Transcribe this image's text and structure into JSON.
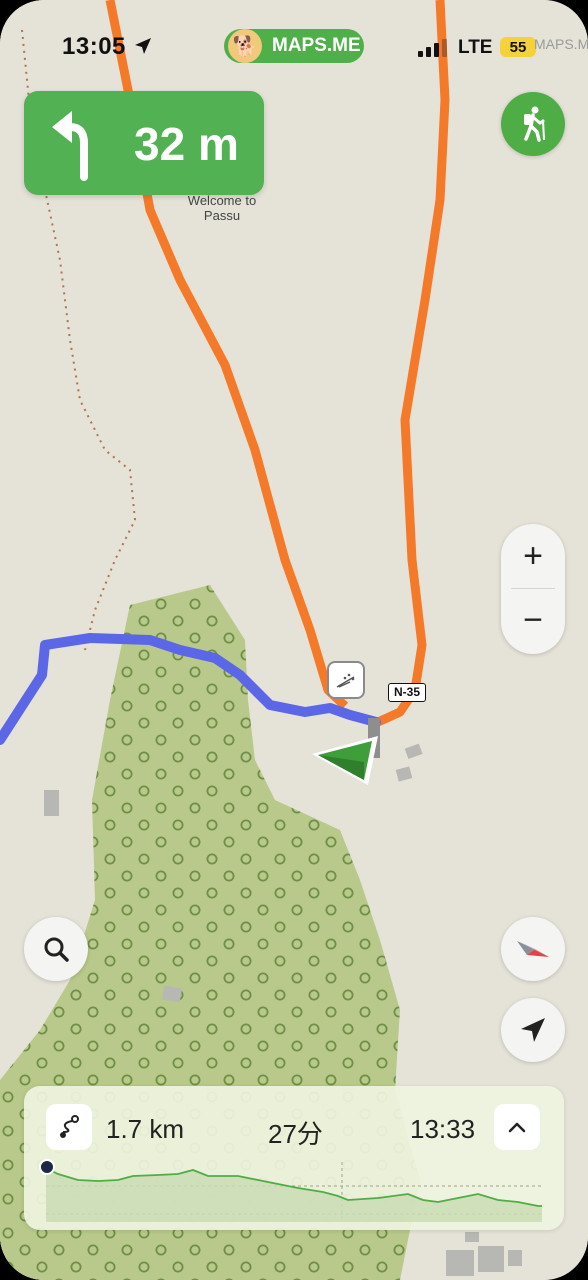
{
  "status_bar": {
    "time": "13:05",
    "app_name": "MAPS.ME",
    "network": "LTE",
    "battery": "55",
    "ghost_label": "MAPS.ME"
  },
  "navigation": {
    "turn_direction": "turn-left",
    "distance_to_turn": "32 m"
  },
  "map": {
    "place_label": "Welcome to Passu",
    "road_badge": "N-35",
    "poi_icon": "viewpoint-icon",
    "colors": {
      "background": "#e5e3d8",
      "forest": "#b9c98b",
      "road": "#f47a2a",
      "route": "#5b67e6",
      "position_arrow": "#3f9d3a"
    }
  },
  "controls": {
    "zoom_in_label": "+",
    "zoom_out_label": "−",
    "walk_mode_icon": "hiker-icon",
    "search_icon": "search-icon",
    "compass_icon": "compass-icon",
    "my_location_icon": "navigation-arrow-icon"
  },
  "route_panel": {
    "distance": "1.7 km",
    "duration": "27分",
    "arrival_time": "13:33",
    "route_icon": "route-icon",
    "expand_icon": "chevron-up-icon"
  }
}
